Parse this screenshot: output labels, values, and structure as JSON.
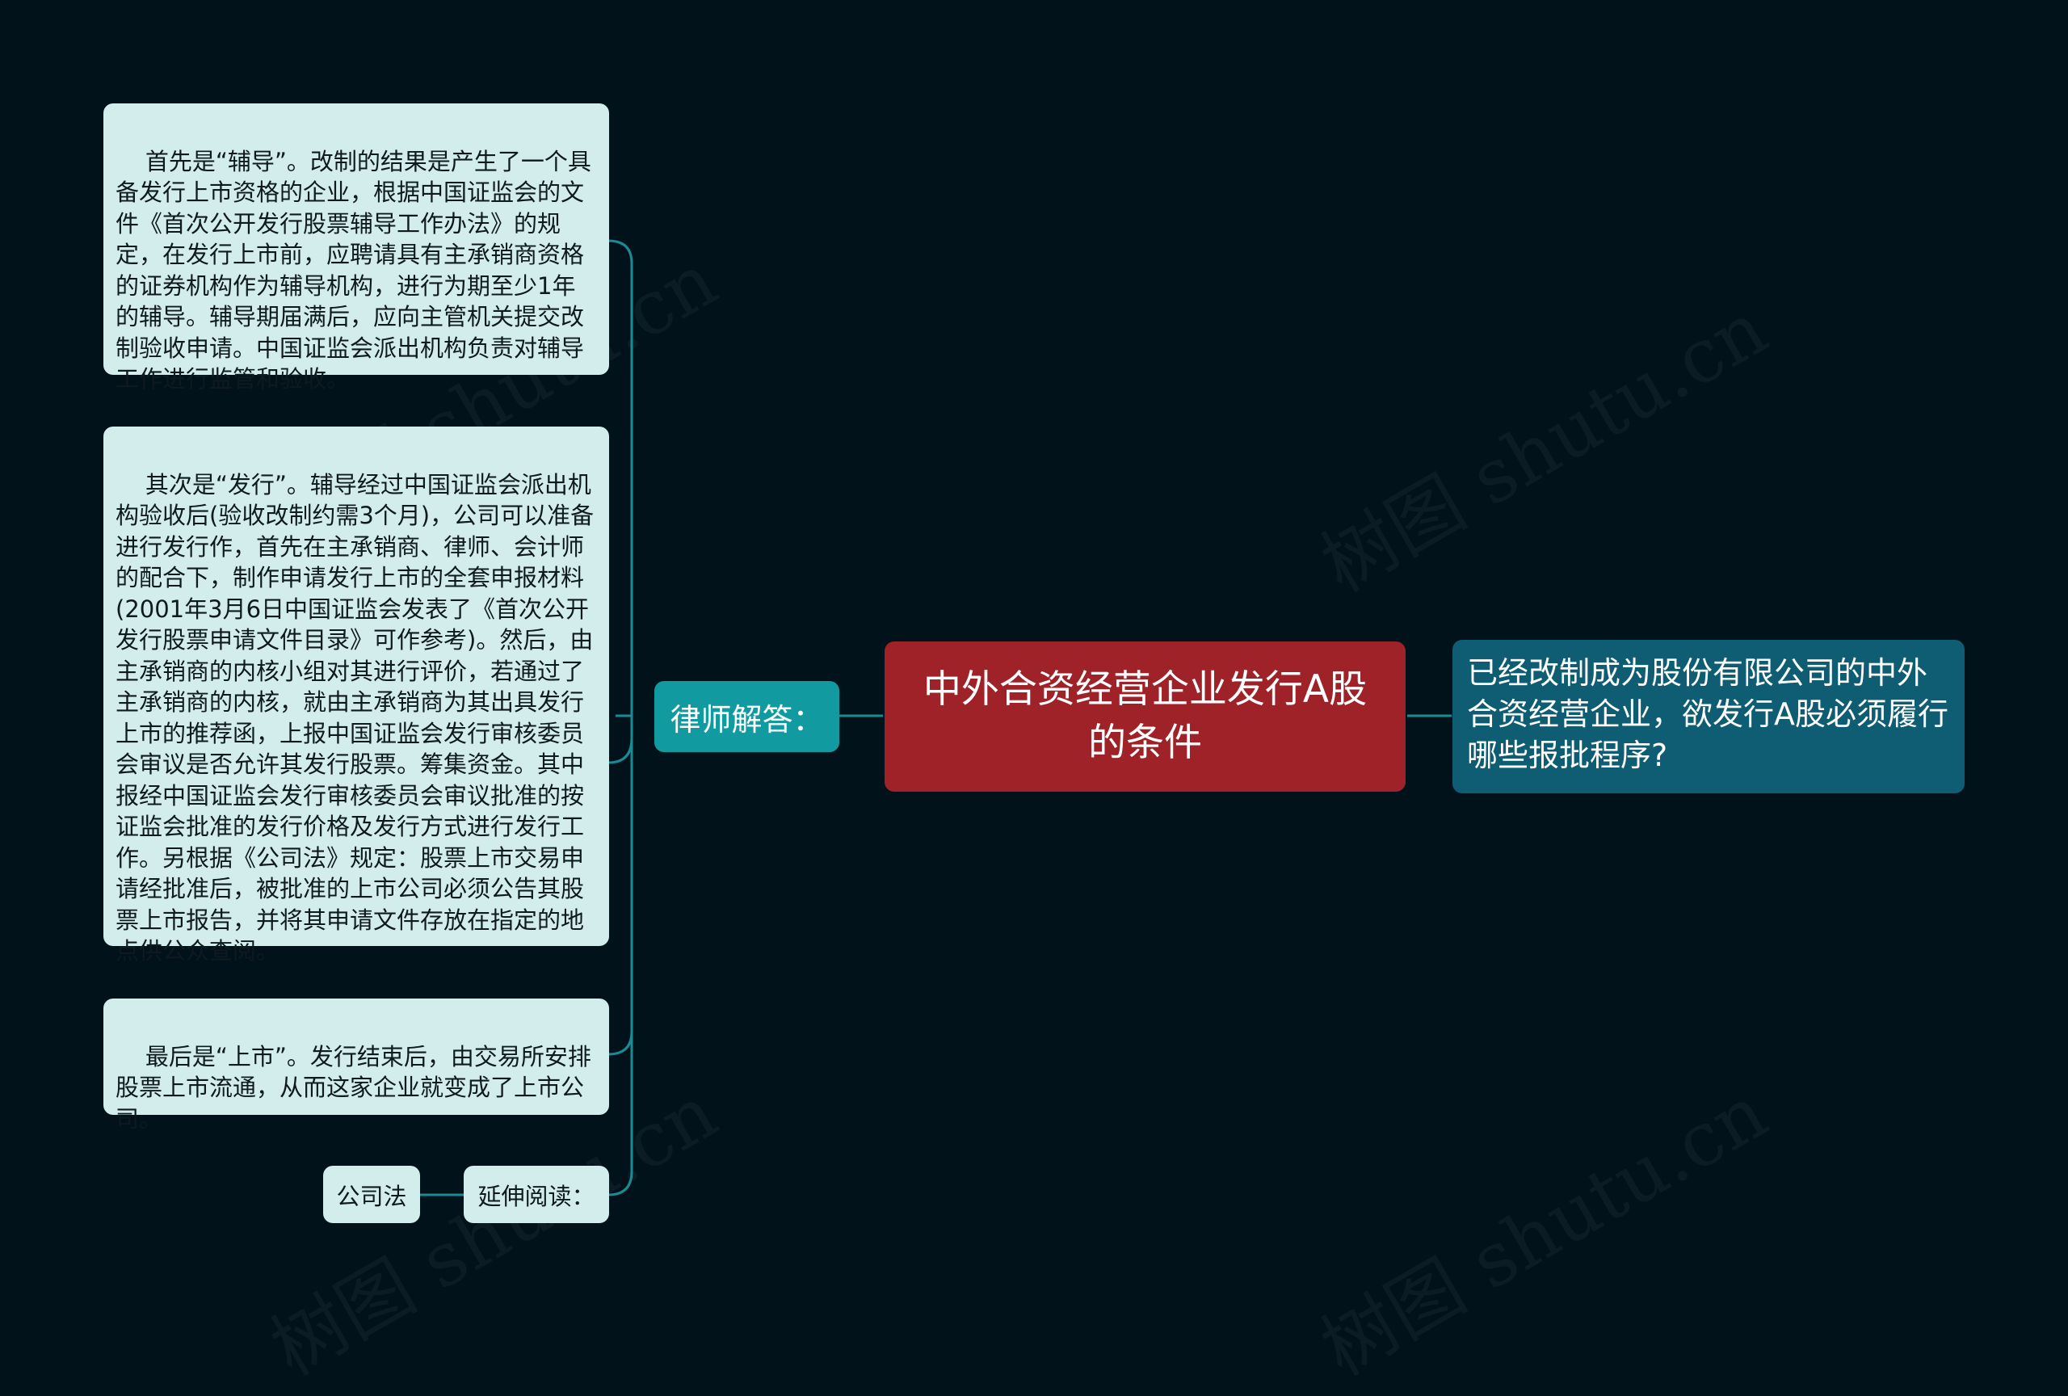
{
  "root": {
    "title": "中外合资经营企业发行A股的条件"
  },
  "question": {
    "text": "已经改制成为股份有限公司的中外合资经营企业，欲发行A股必须履行哪些报批程序?"
  },
  "answer_label": "律师解答：",
  "answers": [
    "首先是“辅导”。改制的结果是产生了一个具备发行上市资格的企业，根据中国证监会的文件《首次公开发行股票辅导工作办法》的规定，在发行上市前，应聘请具有主承销商资格的证券机构作为辅导机构，进行为期至少1年的辅导。辅导期届满后，应向主管机关提交改制验收申请。中国证监会派出机构负责对辅导工作进行监管和验收。",
    "其次是“发行”。辅导经过中国证监会派出机构验收后(验收改制约需3个月)，公司可以准备进行发行作，首先在主承销商、律师、会计师的配合下，制作申请发行上市的全套申报材料(2001年3月6日中国证监会发表了《首次公开发行股票申请文件目录》可作参考)。然后，由主承销商的内核小组对其进行评价，若通过了主承销商的内核，就由主承销商为其出具发行上市的推荐函，上报中国证监会发行审核委员会审议是否允许其发行股票。筹集资金。其中报经中国证监会发行审核委员会审议批准的按证监会批准的发行价格及发行方式进行发行工作。另根据《公司法》规定：股票上市交易申请经批准后，被批准的上市公司必须公告其股票上市报告，并将其申请文件存放在指定的地点供公众查阅。",
    "最后是“上市”。发行结束后，由交易所安排股票上市流通，从而这家企业就变成了上市公司。"
  ],
  "further_reading": {
    "label": "延伸阅读：",
    "item": "公司法"
  },
  "watermark": "树图 shutu.cn",
  "colors": {
    "background": "#02121b",
    "root": "#9e2227",
    "question": "#0f5d72",
    "label": "#129aa1",
    "leaf": "#d3ecec",
    "connector": "#1a8a93"
  }
}
